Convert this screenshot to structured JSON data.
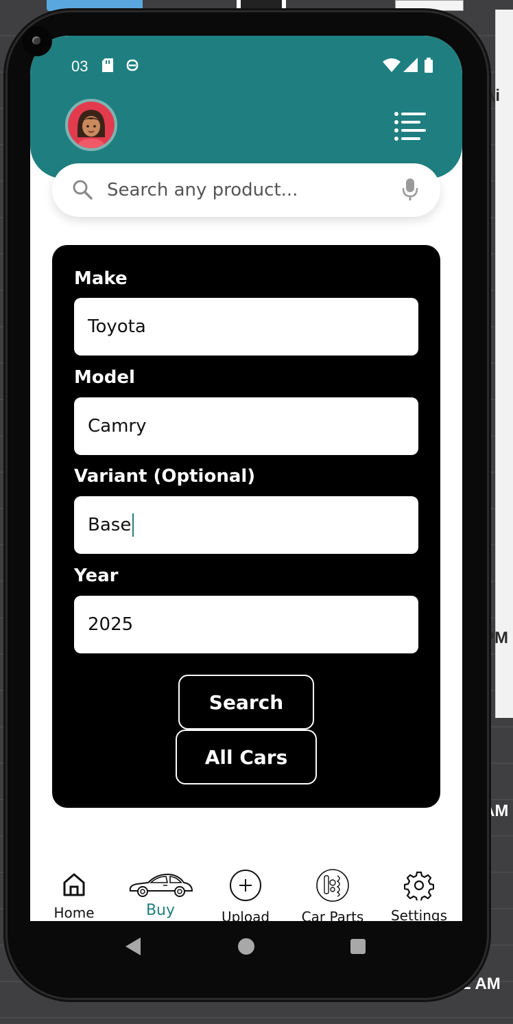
{
  "status_bar": {
    "time": "03"
  },
  "search": {
    "placeholder": "Search any product..."
  },
  "form": {
    "make_label": "Make",
    "make_value": "Toyota",
    "model_label": "Model",
    "model_value": "Camry",
    "variant_label": "Variant (Optional)",
    "variant_value": "Base",
    "year_label": "Year",
    "year_value": "2025",
    "search_button": "Search",
    "all_cars_button": "All Cars"
  },
  "nav": {
    "items": [
      {
        "label": "Home",
        "icon": "home-icon"
      },
      {
        "label": "Buy",
        "icon": "car-icon",
        "active": true
      },
      {
        "label": "Upload",
        "icon": "plus-circle-icon"
      },
      {
        "label": "Car Parts",
        "icon": "car-parts-icon"
      },
      {
        "label": "Settings",
        "icon": "gear-icon"
      }
    ]
  },
  "background": {
    "text_ai": "Ai",
    "text_pm": "PM",
    "text_am": "AM",
    "text_time": "02 AM"
  },
  "colors": {
    "accent": "#1f7f80",
    "card": "#000000",
    "screen": "#ffffff"
  }
}
